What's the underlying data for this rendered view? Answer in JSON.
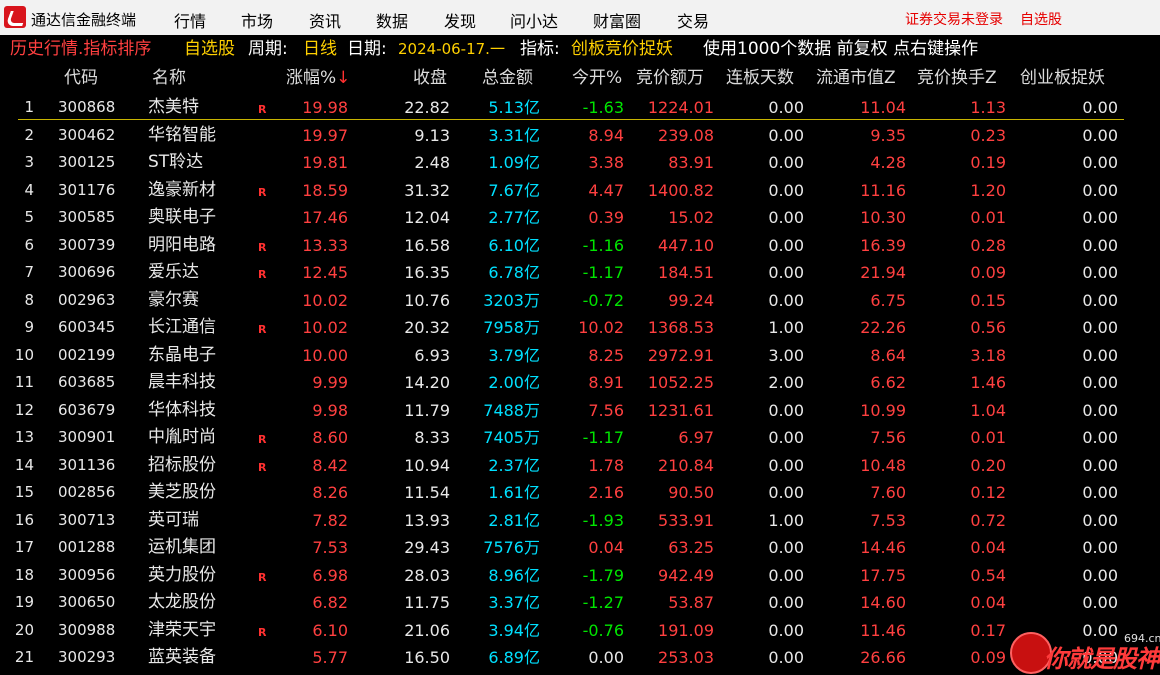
{
  "app": {
    "title": "通达信金融终端"
  },
  "menu": [
    "行情",
    "市场",
    "资讯",
    "数据",
    "发现",
    "问小达",
    "财富圈",
    "交易"
  ],
  "menu_right": {
    "login": "证券交易未登录",
    "watchlist": "自选股"
  },
  "info": {
    "section": "历史行情.指标排序",
    "pool": "自选股",
    "period_label": "周期:",
    "period": "日线",
    "date_label": "日期:",
    "date": "2024-06-17.一",
    "indicator_label": "指标:",
    "indicator": "创板竞价捉妖",
    "usage": "使用1000个数据 前复权 点右键操作"
  },
  "columns": {
    "code": "代码",
    "name": "名称",
    "pct": "涨幅%",
    "sort_arrow": "↓",
    "close": "收盘",
    "amount": "总金额",
    "open": "今开%",
    "bid_amount": "竞价额万",
    "board_days": "连板天数",
    "float_cap": "流通市值Z",
    "bid_turnover": "竞价换手Z",
    "gem": "创业板捉妖"
  },
  "rows": [
    {
      "idx": "1",
      "code": "300868",
      "name": "杰美特",
      "flag": "R",
      "pct": "19.98",
      "close": "22.82",
      "amount": "5.13亿",
      "open": "-1.63",
      "bid": "1224.01",
      "board": "0.00",
      "cap": "11.04",
      "turn": "1.13",
      "gem": "0.00"
    },
    {
      "idx": "2",
      "code": "300462",
      "name": "华铭智能",
      "flag": "",
      "pct": "19.97",
      "close": "9.13",
      "amount": "3.31亿",
      "open": "8.94",
      "bid": "239.08",
      "board": "0.00",
      "cap": "9.35",
      "turn": "0.23",
      "gem": "0.00"
    },
    {
      "idx": "3",
      "code": "300125",
      "name": "ST聆达",
      "flag": "",
      "pct": "19.81",
      "close": "2.48",
      "amount": "1.09亿",
      "open": "3.38",
      "bid": "83.91",
      "board": "0.00",
      "cap": "4.28",
      "turn": "0.19",
      "gem": "0.00"
    },
    {
      "idx": "4",
      "code": "301176",
      "name": "逸豪新材",
      "flag": "R",
      "pct": "18.59",
      "close": "31.32",
      "amount": "7.67亿",
      "open": "4.47",
      "bid": "1400.82",
      "board": "0.00",
      "cap": "11.16",
      "turn": "1.20",
      "gem": "0.00"
    },
    {
      "idx": "5",
      "code": "300585",
      "name": "奥联电子",
      "flag": "",
      "pct": "17.46",
      "close": "12.04",
      "amount": "2.77亿",
      "open": "0.39",
      "bid": "15.02",
      "board": "0.00",
      "cap": "10.30",
      "turn": "0.01",
      "gem": "0.00"
    },
    {
      "idx": "6",
      "code": "300739",
      "name": "明阳电路",
      "flag": "R",
      "pct": "13.33",
      "close": "16.58",
      "amount": "6.10亿",
      "open": "-1.16",
      "bid": "447.10",
      "board": "0.00",
      "cap": "16.39",
      "turn": "0.28",
      "gem": "0.00"
    },
    {
      "idx": "7",
      "code": "300696",
      "name": "爱乐达",
      "flag": "R",
      "pct": "12.45",
      "close": "16.35",
      "amount": "6.78亿",
      "open": "-1.17",
      "bid": "184.51",
      "board": "0.00",
      "cap": "21.94",
      "turn": "0.09",
      "gem": "0.00"
    },
    {
      "idx": "8",
      "code": "002963",
      "name": "豪尔赛",
      "flag": "",
      "pct": "10.02",
      "close": "10.76",
      "amount": "3203万",
      "open": "-0.72",
      "bid": "99.24",
      "board": "0.00",
      "cap": "6.75",
      "turn": "0.15",
      "gem": "0.00"
    },
    {
      "idx": "9",
      "code": "600345",
      "name": "长江通信",
      "flag": "R",
      "pct": "10.02",
      "close": "20.32",
      "amount": "7958万",
      "open": "10.02",
      "bid": "1368.53",
      "board": "1.00",
      "cap": "22.26",
      "turn": "0.56",
      "gem": "0.00"
    },
    {
      "idx": "10",
      "code": "002199",
      "name": "东晶电子",
      "flag": "",
      "pct": "10.00",
      "close": "6.93",
      "amount": "3.79亿",
      "open": "8.25",
      "bid": "2972.91",
      "board": "3.00",
      "cap": "8.64",
      "turn": "3.18",
      "gem": "0.00"
    },
    {
      "idx": "11",
      "code": "603685",
      "name": "晨丰科技",
      "flag": "",
      "pct": "9.99",
      "close": "14.20",
      "amount": "2.00亿",
      "open": "8.91",
      "bid": "1052.25",
      "board": "2.00",
      "cap": "6.62",
      "turn": "1.46",
      "gem": "0.00"
    },
    {
      "idx": "12",
      "code": "603679",
      "name": "华体科技",
      "flag": "",
      "pct": "9.98",
      "close": "11.79",
      "amount": "7488万",
      "open": "7.56",
      "bid": "1231.61",
      "board": "0.00",
      "cap": "10.99",
      "turn": "1.04",
      "gem": "0.00"
    },
    {
      "idx": "13",
      "code": "300901",
      "name": "中胤时尚",
      "flag": "R",
      "pct": "8.60",
      "close": "8.33",
      "amount": "7405万",
      "open": "-1.17",
      "bid": "6.97",
      "board": "0.00",
      "cap": "7.56",
      "turn": "0.01",
      "gem": "0.00"
    },
    {
      "idx": "14",
      "code": "301136",
      "name": "招标股份",
      "flag": "R",
      "pct": "8.42",
      "close": "10.94",
      "amount": "2.37亿",
      "open": "1.78",
      "bid": "210.84",
      "board": "0.00",
      "cap": "10.48",
      "turn": "0.20",
      "gem": "0.00"
    },
    {
      "idx": "15",
      "code": "002856",
      "name": "美芝股份",
      "flag": "",
      "pct": "8.26",
      "close": "11.54",
      "amount": "1.61亿",
      "open": "2.16",
      "bid": "90.50",
      "board": "0.00",
      "cap": "7.60",
      "turn": "0.12",
      "gem": "0.00"
    },
    {
      "idx": "16",
      "code": "300713",
      "name": "英可瑞",
      "flag": "",
      "pct": "7.82",
      "close": "13.93",
      "amount": "2.81亿",
      "open": "-1.93",
      "bid": "533.91",
      "board": "1.00",
      "cap": "7.53",
      "turn": "0.72",
      "gem": "0.00"
    },
    {
      "idx": "17",
      "code": "001288",
      "name": "运机集团",
      "flag": "",
      "pct": "7.53",
      "close": "29.43",
      "amount": "7576万",
      "open": "0.04",
      "bid": "63.25",
      "board": "0.00",
      "cap": "14.46",
      "turn": "0.04",
      "gem": "0.00"
    },
    {
      "idx": "18",
      "code": "300956",
      "name": "英力股份",
      "flag": "R",
      "pct": "6.98",
      "close": "28.03",
      "amount": "8.96亿",
      "open": "-1.79",
      "bid": "942.49",
      "board": "0.00",
      "cap": "17.75",
      "turn": "0.54",
      "gem": "0.00"
    },
    {
      "idx": "19",
      "code": "300650",
      "name": "太龙股份",
      "flag": "",
      "pct": "6.82",
      "close": "11.75",
      "amount": "3.37亿",
      "open": "-1.27",
      "bid": "53.87",
      "board": "0.00",
      "cap": "14.60",
      "turn": "0.04",
      "gem": "0.00"
    },
    {
      "idx": "20",
      "code": "300988",
      "name": "津荣天宇",
      "flag": "R",
      "pct": "6.10",
      "close": "21.06",
      "amount": "3.94亿",
      "open": "-0.76",
      "bid": "191.09",
      "board": "0.00",
      "cap": "11.46",
      "turn": "0.17",
      "gem": "0.00"
    },
    {
      "idx": "21",
      "code": "300293",
      "name": "蓝英装备",
      "flag": "",
      "pct": "5.77",
      "close": "16.50",
      "amount": "6.89亿",
      "open": "0.00",
      "bid": "253.03",
      "board": "0.00",
      "cap": "26.66",
      "turn": "0.09",
      "gem": "0.00"
    }
  ],
  "colors": {
    "up": "#ff4040",
    "down": "#00e600",
    "flat": "#e8e8e8",
    "amount": "#00e0ff",
    "accent": "#ffd000"
  },
  "watermark": {
    "text": "你就是股神",
    "domain": "694.cn"
  }
}
